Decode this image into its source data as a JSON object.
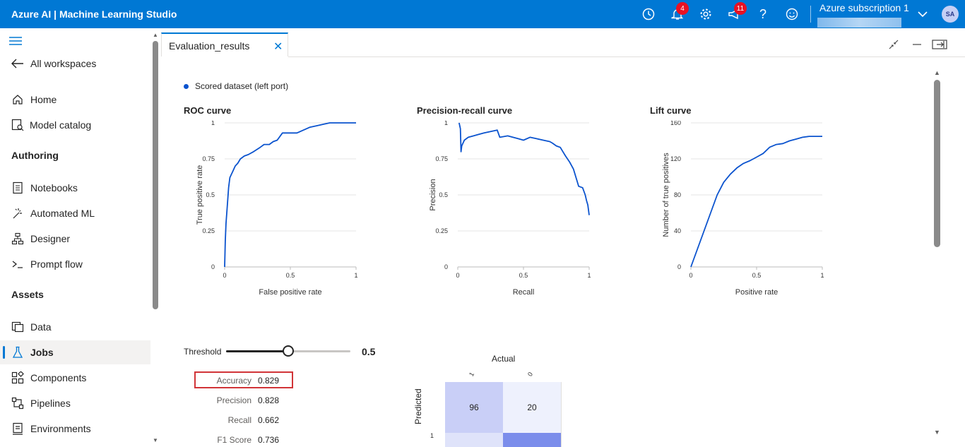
{
  "app": {
    "title": "Azure AI | Machine Learning Studio",
    "notifications_count": "4",
    "feedback_count": "11",
    "subscription": "Azure subscription 1",
    "avatar_initials": "SA"
  },
  "sidebar": {
    "back_label": "All workspaces",
    "top_items": [
      {
        "label": "Home",
        "icon": "home-icon"
      },
      {
        "label": "Model catalog",
        "icon": "model-catalog-icon"
      }
    ],
    "authoring_header": "Authoring",
    "authoring_items": [
      {
        "label": "Notebooks",
        "icon": "notebook-icon"
      },
      {
        "label": "Automated ML",
        "icon": "automl-icon"
      },
      {
        "label": "Designer",
        "icon": "designer-icon"
      },
      {
        "label": "Prompt flow",
        "icon": "prompt-flow-icon"
      }
    ],
    "assets_header": "Assets",
    "assets_items": [
      {
        "label": "Data",
        "icon": "data-icon"
      },
      {
        "label": "Jobs",
        "icon": "jobs-icon",
        "active": true
      },
      {
        "label": "Components",
        "icon": "components-icon"
      },
      {
        "label": "Pipelines",
        "icon": "pipelines-icon"
      },
      {
        "label": "Environments",
        "icon": "environments-icon"
      }
    ]
  },
  "tab": {
    "label": "Evaluation_results"
  },
  "legend": {
    "label": "Scored dataset (left port)",
    "color": "#0b53ce"
  },
  "chart_data": [
    {
      "type": "line",
      "title": "ROC curve",
      "xlabel": "False positive rate",
      "ylabel": "True positive rate",
      "xlim": [
        0,
        1
      ],
      "ylim": [
        0,
        1
      ],
      "xticks": [
        "0",
        "0.5",
        "1"
      ],
      "yticks": [
        "0",
        "0.25",
        "0.5",
        "0.75",
        "1"
      ],
      "grid": true,
      "series": [
        {
          "color": "#0b53ce",
          "x": [
            0,
            0.005,
            0.01,
            0.015,
            0.02,
            0.03,
            0.04,
            0.05,
            0.06,
            0.08,
            0.1,
            0.12,
            0.15,
            0.18,
            0.22,
            0.27,
            0.3,
            0.34,
            0.37,
            0.4,
            0.44,
            0.5,
            0.55,
            0.6,
            0.65,
            0.7,
            0.75,
            0.8,
            0.9,
            1.0
          ],
          "y": [
            0,
            0.18,
            0.3,
            0.36,
            0.42,
            0.55,
            0.62,
            0.64,
            0.66,
            0.7,
            0.72,
            0.75,
            0.77,
            0.78,
            0.8,
            0.83,
            0.85,
            0.85,
            0.87,
            0.88,
            0.93,
            0.93,
            0.93,
            0.95,
            0.97,
            0.98,
            0.99,
            1.0,
            1.0,
            1.0
          ]
        }
      ]
    },
    {
      "type": "line",
      "title": "Precision-recall curve",
      "xlabel": "Recall",
      "ylabel": "Precision",
      "xlim": [
        0,
        1
      ],
      "ylim": [
        0,
        1
      ],
      "xticks": [
        "0",
        "0.5",
        "1"
      ],
      "yticks": [
        "0",
        "0.25",
        "0.5",
        "0.75",
        "1"
      ],
      "grid": true,
      "series": [
        {
          "color": "#0b53ce",
          "x": [
            0.01,
            0.02,
            0.025,
            0.03,
            0.05,
            0.08,
            0.12,
            0.16,
            0.2,
            0.25,
            0.3,
            0.32,
            0.38,
            0.42,
            0.46,
            0.5,
            0.55,
            0.6,
            0.65,
            0.7,
            0.72,
            0.75,
            0.78,
            0.8,
            0.82,
            0.85,
            0.88,
            0.9,
            0.92,
            0.95,
            0.97,
            0.98,
            0.99,
            1.0
          ],
          "y": [
            1.0,
            0.96,
            0.8,
            0.84,
            0.88,
            0.9,
            0.91,
            0.92,
            0.93,
            0.94,
            0.95,
            0.9,
            0.91,
            0.9,
            0.89,
            0.88,
            0.9,
            0.89,
            0.88,
            0.87,
            0.86,
            0.84,
            0.83,
            0.8,
            0.77,
            0.73,
            0.68,
            0.62,
            0.56,
            0.55,
            0.5,
            0.46,
            0.43,
            0.36
          ]
        }
      ]
    },
    {
      "type": "line",
      "title": "Lift curve",
      "xlabel": "Positive rate",
      "ylabel": "Number of true positives",
      "xlim": [
        0,
        1
      ],
      "ylim": [
        0,
        160
      ],
      "xticks": [
        "0",
        "0.5",
        "1"
      ],
      "yticks": [
        "0",
        "40",
        "80",
        "120",
        "160"
      ],
      "grid": true,
      "series": [
        {
          "color": "#0b53ce",
          "x": [
            0,
            0.05,
            0.1,
            0.15,
            0.2,
            0.25,
            0.3,
            0.35,
            0.4,
            0.45,
            0.5,
            0.55,
            0.6,
            0.65,
            0.7,
            0.75,
            0.8,
            0.85,
            0.9,
            0.95,
            1.0
          ],
          "y": [
            0,
            20,
            40,
            60,
            80,
            94,
            103,
            110,
            115,
            118,
            122,
            126,
            133,
            136,
            137,
            140,
            142,
            144,
            145,
            145,
            145
          ]
        }
      ]
    }
  ],
  "threshold": {
    "label": "Threshold",
    "value": "0.5",
    "fraction": 0.5
  },
  "metrics": [
    {
      "name": "Accuracy",
      "value": "0.829",
      "highlighted": true
    },
    {
      "name": "Precision",
      "value": "0.828"
    },
    {
      "name": "Recall",
      "value": "0.662"
    },
    {
      "name": "F1 Score",
      "value": "0.736"
    }
  ],
  "confusion_matrix": {
    "title": "Actual",
    "ylabel": "Predicted",
    "col_headers": [
      "1",
      "0"
    ],
    "row_headers": [
      "1"
    ],
    "cells": [
      [
        "96",
        "20"
      ]
    ],
    "colors": [
      [
        "#c9cff7",
        "#eef1fd"
      ],
      [
        "#dfe3fa",
        "#7b8deb"
      ]
    ]
  }
}
